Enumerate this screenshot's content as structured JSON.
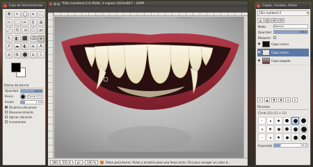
{
  "toolbox": {
    "title": "Caja de herramientas",
    "tool_icons": [
      "✥",
      "⌖",
      "◯",
      "⌗",
      "⛶",
      "✂",
      "⬚",
      "✏",
      "⚲",
      "⊞",
      "⤢",
      "⟲",
      "⇲",
      "⬡",
      "⇄",
      "✎",
      "◧",
      "⬛",
      "⌫",
      "⚹",
      "✐",
      "☁",
      "◐",
      "≡",
      "A",
      "⌀",
      "⊕",
      "⬤",
      "⌂",
      "⟟"
    ],
    "options_title": "Dama de borrar",
    "options": [
      {
        "label": "Opacidad",
        "value": "100.0"
      },
      {
        "label": "Pincel",
        "value": "Circle (11)"
      },
      {
        "label": "Escala",
        "value": "1.00"
      }
    ],
    "checks": [
      {
        "label": "Dinámica del pincel",
        "on": true
      },
      {
        "label": "Desvanecimiento",
        "on": false
      },
      {
        "label": "Aplicar vibración",
        "on": false
      },
      {
        "label": "Incremental",
        "on": false
      }
    ]
  },
  "main": {
    "title": "*[Sin nombre]-2.0 (RGB, 3 capas) 1024x807 – GIMP",
    "status": {
      "coords": "380.0, 501.8",
      "unit": "px",
      "zoom": "100 %",
      "message": "Pulse para borrar. Pulse y arrastre para una línea recta. Ctrl para recoger un color d..."
    }
  },
  "dock": {
    "title": "Capas, Canales, Rutas",
    "image_select": "[Sin nombre]-2",
    "mode_label": "Modo",
    "mode_value": "Normal",
    "opacity_label": "Opacidad",
    "opacity_value": "100.0",
    "lock_label": "Bloquear:",
    "layers": [
      {
        "name": "Capa nueva",
        "selected": false
      },
      {
        "name": "Capa nueva",
        "selected": true
      },
      {
        "name": "Capa pegada",
        "selected": false
      }
    ],
    "brushes_title": "Pinceles",
    "brush_name": "Circle (11) (11 × 11)",
    "spacing_label": "Espaciado",
    "spacing_value": "20.0"
  }
}
